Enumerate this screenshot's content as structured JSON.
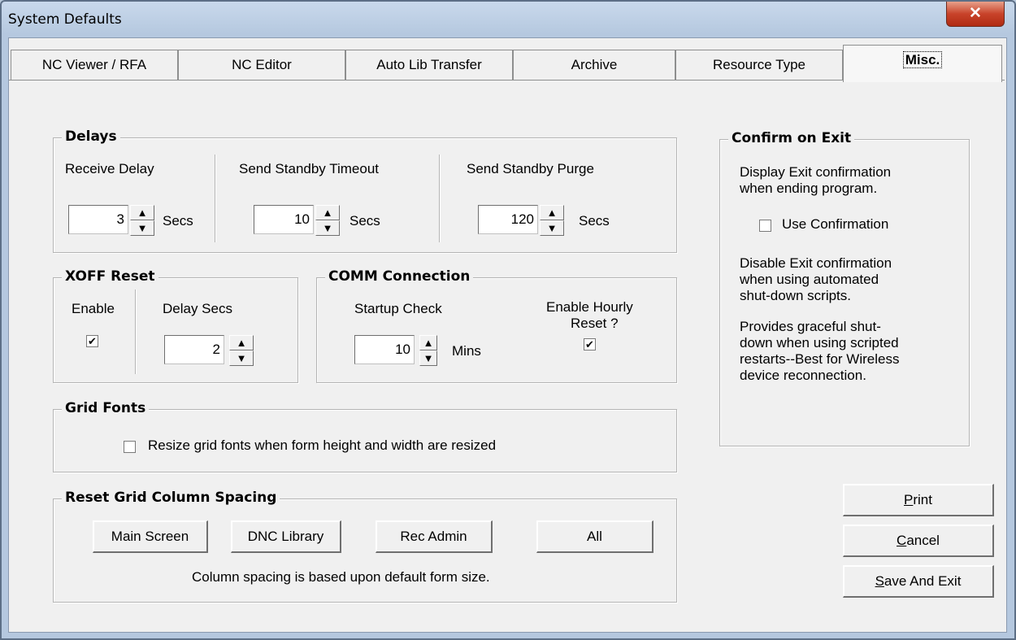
{
  "window": {
    "title": "System Defaults",
    "close_glyph": "✕"
  },
  "tabs": [
    {
      "label": "NC Viewer / RFA"
    },
    {
      "label": "NC Editor"
    },
    {
      "label": "Auto Lib Transfer"
    },
    {
      "label": "Archive"
    },
    {
      "label": "Resource Type"
    },
    {
      "label": "Misc."
    }
  ],
  "delays": {
    "title": "Delays",
    "receive_label": "Receive Delay",
    "receive_value": "3",
    "standby_timeout_label": "Send Standby Timeout",
    "standby_timeout_value": "10",
    "standby_purge_label": "Send Standby Purge",
    "standby_purge_value": "120",
    "unit": "Secs"
  },
  "xoff": {
    "title": "XOFF Reset",
    "enable_label": "Enable",
    "enable_checked": true,
    "delay_label": "Delay Secs",
    "delay_value": "2"
  },
  "comm": {
    "title": "COMM Connection",
    "startup_label": "Startup Check",
    "startup_value": "10",
    "startup_unit": "Mins",
    "hourly_label_1": "Enable Hourly",
    "hourly_label_2": "Reset ?",
    "hourly_checked": true
  },
  "grid_fonts": {
    "title": "Grid Fonts",
    "resize_label": "Resize grid fonts when form height and width are resized",
    "resize_checked": false
  },
  "reset_grid": {
    "title": "Reset Grid Column Spacing",
    "buttons": [
      "Main Screen",
      "DNC Library",
      "Rec Admin",
      "All"
    ],
    "note": "Column spacing is based upon default form size."
  },
  "confirm": {
    "title": "Confirm on Exit",
    "desc_1": "Display Exit confirmation",
    "desc_2": "when ending program.",
    "use_label": "Use Confirmation",
    "use_checked": false,
    "disable_1": "Disable Exit confirmation",
    "disable_2": "when using automated",
    "disable_3": "shut-down scripts.",
    "graceful_1": "Provides graceful shut-",
    "graceful_2": "down when using  scripted",
    "graceful_3": "restarts--Best for Wireless",
    "graceful_4": "device reconnection."
  },
  "actions": {
    "print_u": "P",
    "print_rest": "rint",
    "cancel_u": "C",
    "cancel_rest": "ancel",
    "save_u": "S",
    "save_rest": "ave And Exit"
  },
  "glyphs": {
    "up": "▲",
    "down": "▼",
    "check": "✔"
  }
}
